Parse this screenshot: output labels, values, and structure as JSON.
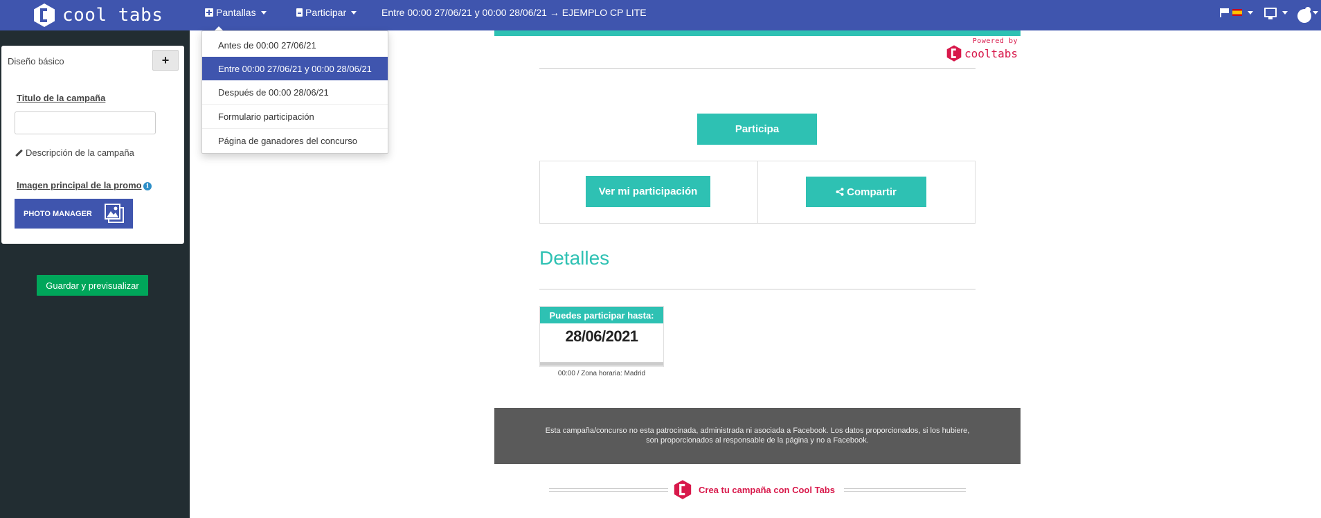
{
  "brand": {
    "name": "cool tabs",
    "accent": "#3f55ae",
    "teal": "#2ec1b3",
    "red": "#d8194b"
  },
  "navbar": {
    "pantallas_label": "Pantallas",
    "participar_label": "Participar",
    "current_screen": "Entre 00:00 27/06/21 y 00:00 28/06/21 → EJEMPLO CP LITE",
    "language_icon": "flag-icon",
    "language_flag": "es",
    "device_icon": "monitor-icon",
    "settings_icon": "cogs-icon"
  },
  "dropdown": {
    "items": [
      {
        "label": "Antes de 00:00 27/06/21",
        "active": false
      },
      {
        "label": "Entre 00:00 27/06/21 y 00:00 28/06/21",
        "active": true
      },
      {
        "label": "Después de 00:00 28/06/21",
        "active": false
      },
      {
        "label": "Formulario participación",
        "active": false
      },
      {
        "label": "Página de ganadores del concurso",
        "active": false
      }
    ]
  },
  "sidebar": {
    "panel_title": "Diseño básico",
    "add_label": "+",
    "campaign_title_label": "Titulo de la campaña",
    "campaign_title_value": "",
    "description_label": "Descripción de la campaña",
    "image_label": "Imagen principal de la promo",
    "info_glyph": "i",
    "photo_manager_label": "PHOTO MANAGER",
    "save_label": "Guardar y previsualizar"
  },
  "preview": {
    "powered_by": "Powered by",
    "powered_brand": "cooltabs",
    "participa_label": "Participa",
    "ver_label": "Ver mi participación",
    "share_label": "Compartir",
    "detalles_title": "Detalles",
    "date_card": {
      "header": "Puedes participar hasta:",
      "date": "28/06/2021",
      "timezone": "00:00 / Zona horaria: Madrid"
    },
    "footer_line1": "Esta campaña/concurso no esta patrocinada, administrada ni asociada a Facebook. Los datos proporcionados, si los hubiere,",
    "footer_line2": "son proporcionados al responsable de la página y no a Facebook.",
    "cta_label": "Crea tu campaña con Cool Tabs"
  }
}
